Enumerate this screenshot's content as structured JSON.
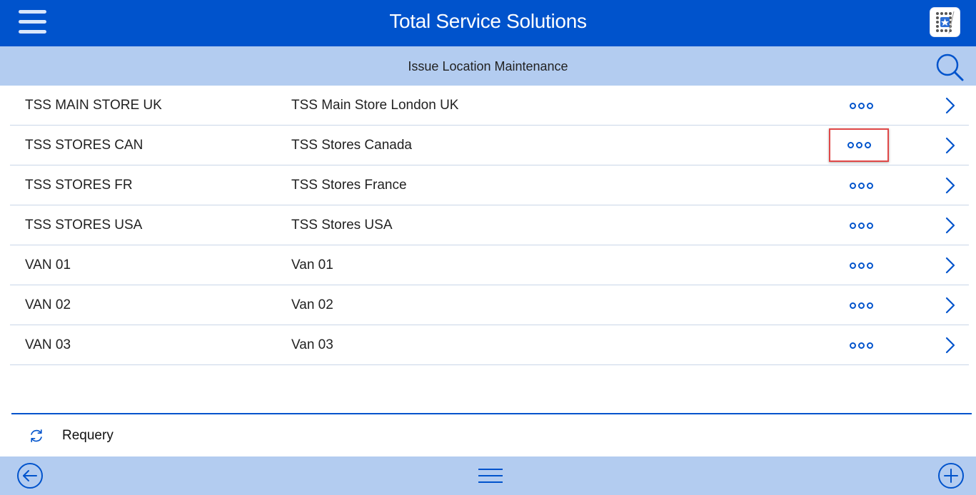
{
  "header": {
    "title": "Total Service Solutions",
    "menu_icon": "hamburger-menu-icon",
    "logo_icon": "app-logo-icon"
  },
  "subheader": {
    "title": "Issue Location Maintenance",
    "search_icon": "search-icon"
  },
  "rows": [
    {
      "code": "TSS MAIN STORE UK",
      "description": "TSS Main Store London UK"
    },
    {
      "code": "TSS STORES CAN",
      "description": "TSS Stores Canada",
      "highlighted_more": true
    },
    {
      "code": "TSS STORES FR",
      "description": "TSS Stores France"
    },
    {
      "code": "TSS STORES USA",
      "description": "TSS Stores USA"
    },
    {
      "code": "VAN 01",
      "description": "Van 01"
    },
    {
      "code": "VAN 02",
      "description": "Van 02"
    },
    {
      "code": "VAN 03",
      "description": "Van 03"
    }
  ],
  "footer": {
    "requery_label": "Requery",
    "requery_icon": "refresh-icon"
  },
  "bottom_bar": {
    "back_icon": "back-arrow-icon",
    "menu_icon": "list-menu-icon",
    "add_icon": "add-icon"
  },
  "colors": {
    "primary": "#0053cc",
    "header_light": "#b3ccf0",
    "highlight_border": "#e04848"
  }
}
